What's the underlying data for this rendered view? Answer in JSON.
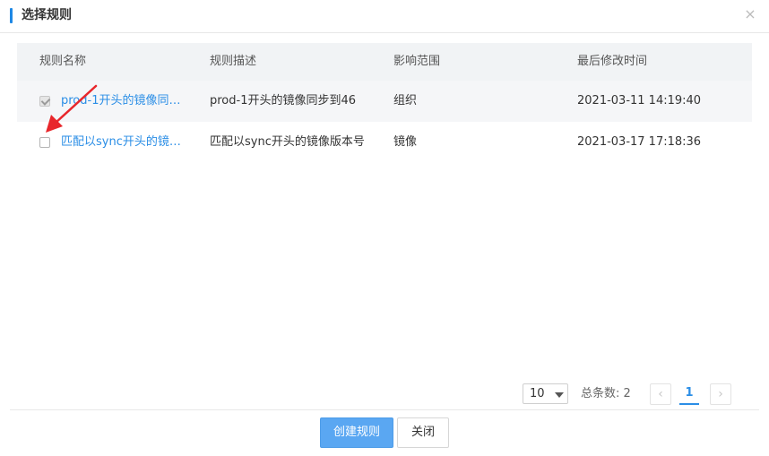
{
  "dialog": {
    "title": "选择规则",
    "close_glyph": "×"
  },
  "table": {
    "headers": [
      "规则名称",
      "规则描述",
      "影响范围",
      "最后修改时间"
    ],
    "rows": [
      {
        "checked": true,
        "name": "prod-1开头的镜像同步...",
        "description": "prod-1开头的镜像同步到46",
        "scope": "组织",
        "modified": "2021-03-11 14:19:40"
      },
      {
        "checked": false,
        "name": "匹配以sync开头的镜像...",
        "description": "匹配以sync开头的镜像版本号",
        "scope": "镜像",
        "modified": "2021-03-17 17:18:36"
      }
    ]
  },
  "pagination": {
    "page_size": "10",
    "total_label": "总条数: 2",
    "prev_glyph": "‹",
    "current_page": "1",
    "next_glyph": "›"
  },
  "footer": {
    "create_label": "创建规则",
    "close_label": "关闭"
  },
  "colors": {
    "accent": "#1e88e5",
    "link": "#2b8ee6",
    "primary_button": "#5aa7f2",
    "annotation_arrow": "#e8262b"
  },
  "icons": {
    "close": "close-icon",
    "dropdown": "chevron-down-icon",
    "prev": "chevron-left-icon",
    "next": "chevron-right-icon",
    "annotation": "red-arrow-icon"
  }
}
